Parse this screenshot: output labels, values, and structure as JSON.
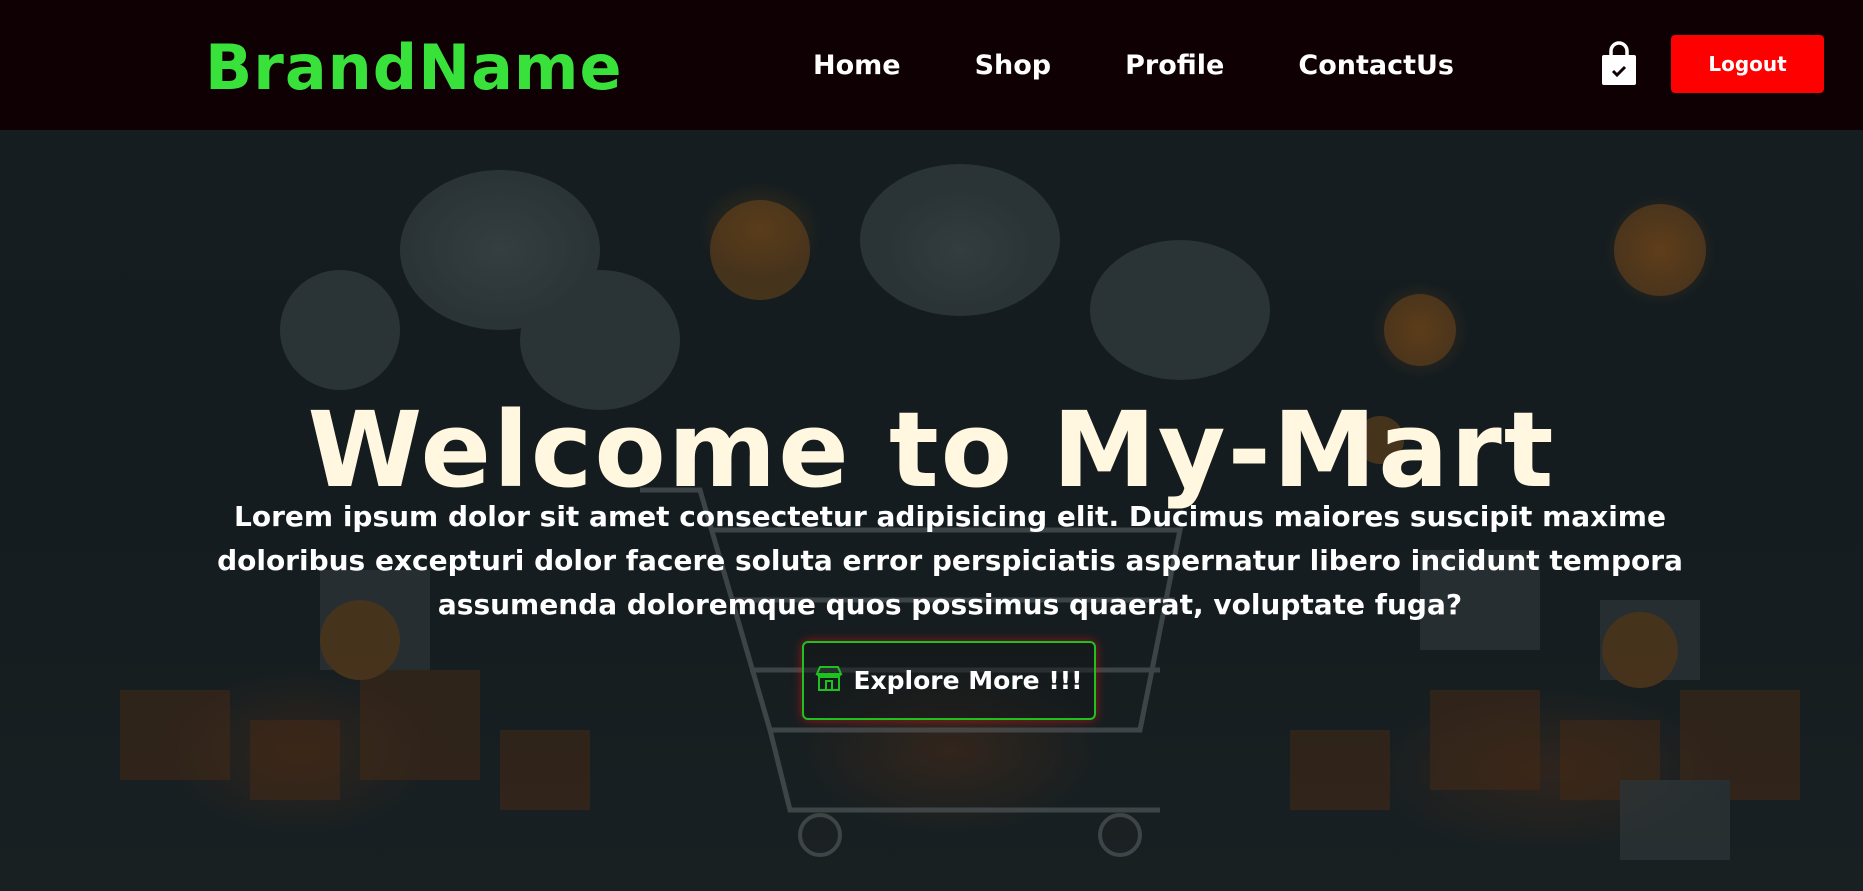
{
  "brand": {
    "name": "BrandName",
    "color": "#39e23a"
  },
  "nav": {
    "items": [
      {
        "label": "Home"
      },
      {
        "label": "Shop"
      },
      {
        "label": "Profile"
      },
      {
        "label": "ContactUs"
      }
    ],
    "cart_icon": "shopping-bag-icon",
    "logout_label": "Logout",
    "logout_color": "#ff0000"
  },
  "hero": {
    "title": "Welcome to My-Mart",
    "description": "Lorem ipsum dolor sit amet consectetur adipisicing elit. Ducimus maiores suscipit maxime doloribus excepturi dolor facere soluta error perspiciatis aspernatur libero incidunt tempora assumenda doloremque quos possimus quaerat, voluptate fuga?",
    "cta_label": "Explore More !!!",
    "cta_icon": "store-icon",
    "cta_border_color": "#1fc11f"
  }
}
